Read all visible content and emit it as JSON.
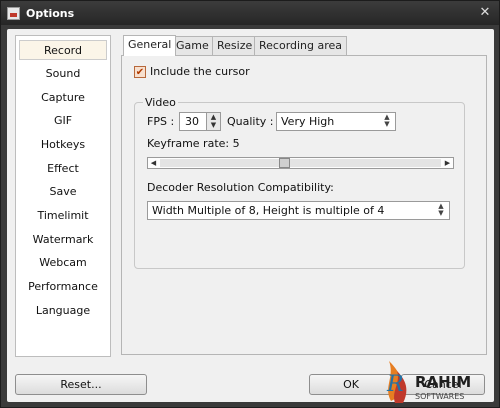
{
  "window": {
    "title": "Options",
    "close_glyph": "✕"
  },
  "sidebar": {
    "items": [
      {
        "label": "Record",
        "selected": true
      },
      {
        "label": "Sound"
      },
      {
        "label": "Capture"
      },
      {
        "label": "GIF"
      },
      {
        "label": "Hotkeys"
      },
      {
        "label": "Effect"
      },
      {
        "label": "Save"
      },
      {
        "label": "Timelimit"
      },
      {
        "label": "Watermark"
      },
      {
        "label": "Webcam"
      },
      {
        "label": "Performance"
      },
      {
        "label": "Language"
      }
    ]
  },
  "tabs": [
    {
      "label": "General",
      "active": true
    },
    {
      "label": "Game"
    },
    {
      "label": "Resize"
    },
    {
      "label": "Recording area"
    }
  ],
  "general": {
    "include_cursor": {
      "label": "Include the cursor",
      "checked": true,
      "check_glyph": "✔"
    },
    "video_group": {
      "title": "Video",
      "fps_label": "FPS :",
      "fps_value": "30",
      "quality_label": "Quality :",
      "quality_value": "Very High",
      "keyframe_label": "Keyframe rate: 5",
      "keyframe_value": 5,
      "decoder_label": "Decoder Resolution Compatibility:",
      "decoder_value": "Width Multiple of 8, Height is multiple of 4"
    }
  },
  "buttons": {
    "reset": "Reset...",
    "ok": "OK",
    "cancel": "Cancel"
  },
  "watermark": {
    "line1": "RAHIM",
    "line2": "SOFTWARES",
    "initial": "R"
  },
  "colors": {
    "accent": "#e67e22",
    "titlebar": "#2e2e2e",
    "selected_item": "#fbf5e8"
  }
}
